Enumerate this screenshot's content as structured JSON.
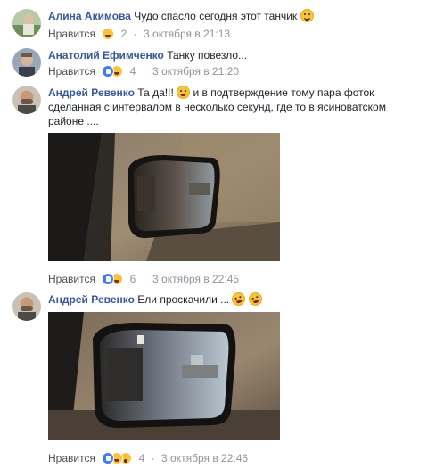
{
  "comments": [
    {
      "author": "Алина Акимова",
      "text": "Чудо спасло сегодня этот танчик",
      "like_label": "Нравится",
      "reaction_count": "2",
      "date": "3 октября в 21:13",
      "reactions": [
        "haha-icon"
      ]
    },
    {
      "author": "Анатолий Ефимченко",
      "text": "Танку повезло...",
      "like_label": "Нравится",
      "reaction_count": "4",
      "date": "3 октября в 21:20",
      "reactions": [
        "like-icon",
        "haha-icon"
      ]
    },
    {
      "author": "Андрей Ревенко",
      "text_part1": "Та да!!!",
      "text_part2": "и в подтверждение тому пара фоток сделанная с интервалом в несколько секунд, где то в ясиноватском районе ....",
      "like_label": "Нравится",
      "reaction_count": "6",
      "date": "3 октября в 22:45",
      "reactions": [
        "like-icon",
        "haha-icon"
      ]
    },
    {
      "author": "Андрей Ревенко",
      "text": "Ели проскачили ...",
      "like_label": "Нравится",
      "reaction_count": "4",
      "date": "3 октября в 22:46",
      "reactions": [
        "like-icon",
        "haha-icon",
        "wow-icon"
      ]
    }
  ],
  "separator": "·",
  "colors": {
    "name": "#385898",
    "meta": "#90949c",
    "text": "#1d2129",
    "like_blue": "#3b7cf6",
    "emoji_yellow": "#f7c33a"
  }
}
